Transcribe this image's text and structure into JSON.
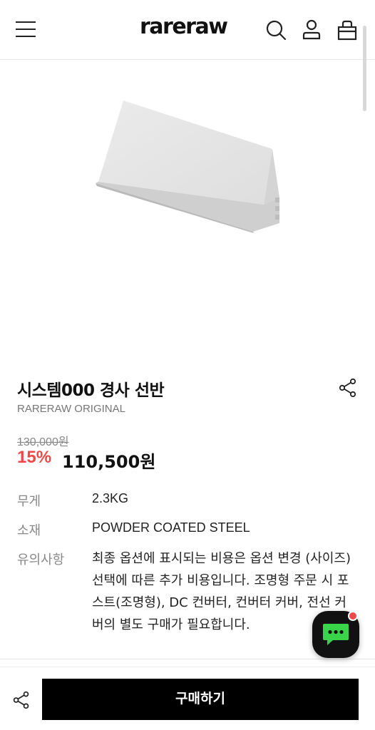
{
  "header": {
    "logo": "rareraw",
    "icons": [
      "menu-icon",
      "search-icon",
      "user-icon",
      "bag-icon"
    ]
  },
  "product": {
    "title": "시스템000 경사 선반",
    "brand": "RARERAW ORIGINAL",
    "original_price": "130,000원",
    "discount": "15%",
    "price": "110,500원"
  },
  "specs": [
    {
      "label": "무게",
      "value": "2.3KG"
    },
    {
      "label": "소재",
      "value": "POWDER COATED STEEL"
    },
    {
      "label": "유의사항",
      "value": "최종 옵션에 표시되는 비용은 옵션 변경 (사이즈) 선택에 따른 추가 비용입니다. 조명형 주문 시 포스트(조명형), DC 컨버터, 컨버터 커버, 전선 커버의 별도 구매가 필요합니다."
    }
  ],
  "bottom_bar": {
    "buy_label": "구매하기"
  },
  "colors": {
    "discount": "#ef4848",
    "button": "#000000",
    "chat_accent": "#3ad44a"
  }
}
